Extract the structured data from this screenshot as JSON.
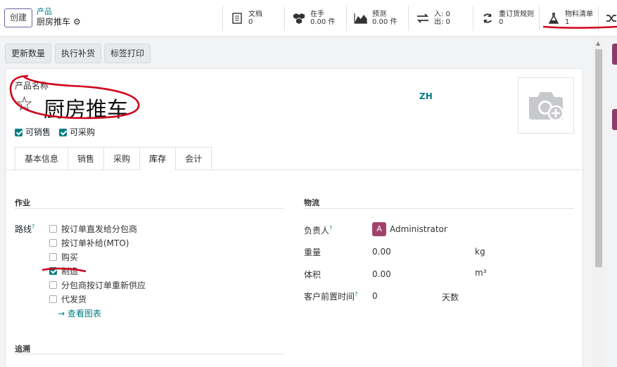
{
  "topbar": {
    "create_label": "创建",
    "breadcrumb_parent": "产品",
    "breadcrumb_current": "厨房推车",
    "stats": [
      {
        "label": "文档",
        "value": "0"
      },
      {
        "label": "在手",
        "value": "0.00 件"
      },
      {
        "label": "预测",
        "value": "0.00 件"
      },
      {
        "label": "入: 0",
        "value": "出: 0"
      },
      {
        "label": "重订货规则",
        "value": "0"
      },
      {
        "label": "物料清单",
        "value": "1"
      }
    ]
  },
  "actions": {
    "update_qty": "更新数量",
    "replenish": "执行补货",
    "print_labels": "标签打印"
  },
  "product": {
    "name_label": "产品名称",
    "name": "厨房推车",
    "lang": "ZH",
    "can_sell": "可销售",
    "can_purchase": "可采购"
  },
  "tabs": [
    "基本信息",
    "销售",
    "采购",
    "库存",
    "会计"
  ],
  "operations": {
    "heading": "作业",
    "routes_label": "路线",
    "routes": [
      {
        "label": "按订单直发给分包商",
        "checked": false
      },
      {
        "label": "按订单补给(MTO)",
        "checked": false
      },
      {
        "label": "购买",
        "checked": false
      },
      {
        "label": "制造",
        "checked": true
      },
      {
        "label": "分包商按订单重新供应",
        "checked": false
      },
      {
        "label": "代发货",
        "checked": false
      }
    ],
    "view_chart": "→ 查看图表"
  },
  "logistics": {
    "heading": "物流",
    "responsible_label": "负责人",
    "responsible_initial": "A",
    "responsible_name": "Administrator",
    "weight_label": "重量",
    "weight_value": "0.00",
    "weight_unit": "kg",
    "volume_label": "体积",
    "volume_value": "0.00",
    "volume_unit": "m³",
    "lead_time_label": "客户前置时间",
    "lead_time_value": "0",
    "lead_time_unit": "天数"
  },
  "traceability": {
    "heading": "追溯"
  },
  "colors": {
    "accent": "#017e84",
    "primary": "#71639e",
    "annotation": "#d0021b"
  }
}
